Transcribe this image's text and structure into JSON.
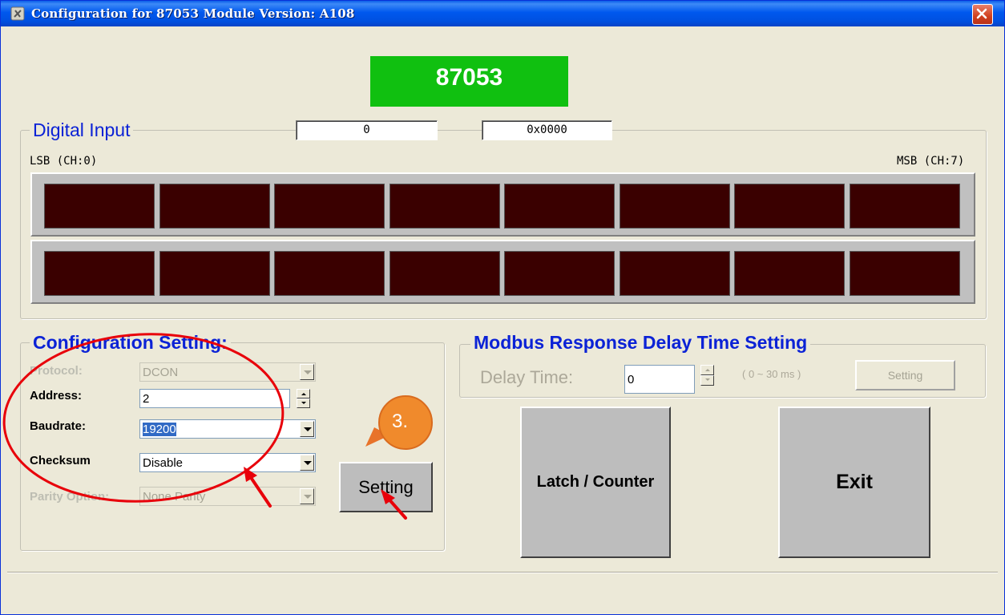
{
  "window": {
    "title": "Configuration for 87053 Module Version: A108",
    "close_label": "×"
  },
  "module": {
    "name": "87053"
  },
  "digital_input": {
    "legend": "Digital Input",
    "decimal_value": "0",
    "hex_value": "0x0000",
    "lsb_label": "LSB (CH:0)",
    "msb_label": "MSB (CH:7)"
  },
  "config": {
    "legend": "Configuration Setting:",
    "protocol_label": "Protocol:",
    "protocol_value": "DCON",
    "address_label": "Address:",
    "address_value": "2",
    "baudrate_label": "Baudrate:",
    "baudrate_value": "19200",
    "checksum_label": "Checksum",
    "checksum_value": "Disable",
    "parity_label": "Parity Option:",
    "parity_value": "None Parity",
    "setting_button": "Setting"
  },
  "modbus": {
    "legend": "Modbus Response Delay Time Setting",
    "delay_label": "Delay Time:",
    "delay_value": "0",
    "range_text": "( 0 ~ 30 ms )",
    "setting_button": "Setting"
  },
  "buttons": {
    "latch_counter": "Latch / Counter",
    "exit": "Exit"
  },
  "annotation": {
    "step_badge": "3."
  },
  "colors": {
    "module_badge": "#10c010",
    "led_off": "#3a0000",
    "group_title": "#0b22d6",
    "annotation": "#e8000a",
    "badge": "#f08a2c"
  }
}
